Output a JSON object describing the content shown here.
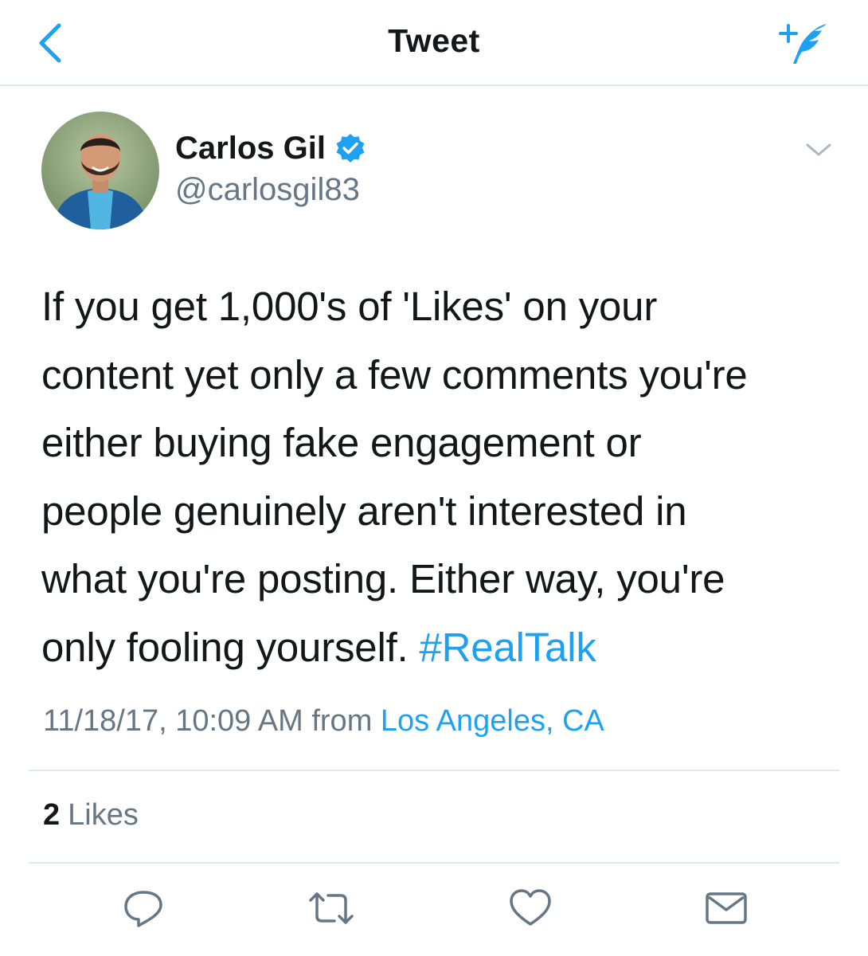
{
  "nav": {
    "title": "Tweet",
    "back_icon": "chevron-left-icon",
    "compose_icon": "compose-feather-icon"
  },
  "author": {
    "name": "Carlos Gil",
    "handle": "@carlosgil83",
    "verified": true,
    "avatar_icon": "profile-photo"
  },
  "tweet": {
    "line_1": "If you get 1,000's of 'Likes' on your",
    "line_2": "content yet only a few comments you're",
    "line_3": "either buying fake engagement or",
    "line_4": "people genuinely aren't interested in",
    "line_5": "what you're posting. Either way, you're",
    "line_6_text": "only fooling yourself. ",
    "hashtag": "#RealTalk"
  },
  "meta": {
    "timestamp": "11/18/17, 10:09 AM",
    "from": "from",
    "location": "Los Angeles, CA"
  },
  "stats": {
    "likes_count": "2",
    "likes_label": "Likes"
  },
  "actions": [
    {
      "name": "reply",
      "icon": "reply-icon"
    },
    {
      "name": "retweet",
      "icon": "retweet-icon"
    },
    {
      "name": "like",
      "icon": "heart-icon"
    },
    {
      "name": "message",
      "icon": "envelope-icon"
    }
  ],
  "colors": {
    "accent": "#1da1f2",
    "text": "#14171a",
    "secondary": "#657786",
    "divider": "#e1e8ed"
  }
}
